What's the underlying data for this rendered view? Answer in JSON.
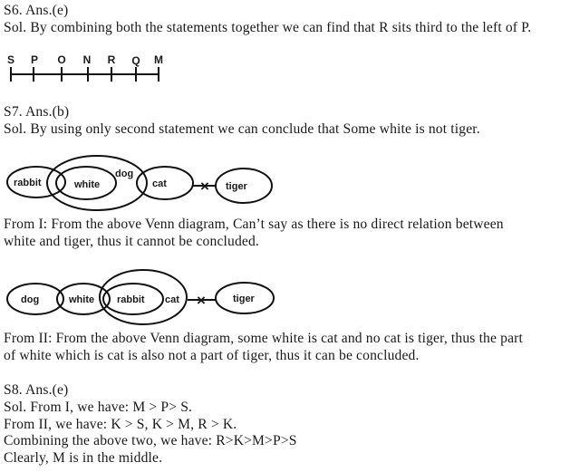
{
  "s6": {
    "title": "S6. Ans.(e)",
    "solution": "Sol. By combining both the statements together we can find that R sits third to the left of P.",
    "arrangement": [
      "S",
      "P",
      "O",
      "N",
      "R",
      "Q",
      "M"
    ]
  },
  "s7": {
    "title": "S7. Ans.(b)",
    "solution": "Sol. By using only second statement we can conclude that Some white is not tiger.",
    "venn1": {
      "labels": {
        "rabbit": "rabbit",
        "white": "white",
        "dog": "dog",
        "cat": "cat",
        "tiger": "tiger"
      },
      "no_relation_mark": "×"
    },
    "from1": [
      "From I: From the above Venn diagram, Can’t say as there is no direct relation between",
      "white and tiger, thus it cannot be concluded."
    ],
    "venn2": {
      "labels": {
        "dog": "dog",
        "white": "white",
        "rabbit": "rabbit",
        "cat": "cat",
        "tiger": "tiger"
      },
      "no_relation_mark": "×"
    },
    "from2": [
      "From II: From the above Venn diagram, some white is cat and no cat is tiger, thus the part",
      "of white which is cat is also not a part of tiger, thus it can be concluded."
    ]
  },
  "s8": {
    "title": "S8. Ans.(e)",
    "lines": [
      "Sol. From I, we have: M > P> S.",
      "From II, we have: K > S, K > M, R > K.",
      "Combining the above two, we have: R>K>M>P>S",
      "Clearly, M is in the middle."
    ]
  }
}
